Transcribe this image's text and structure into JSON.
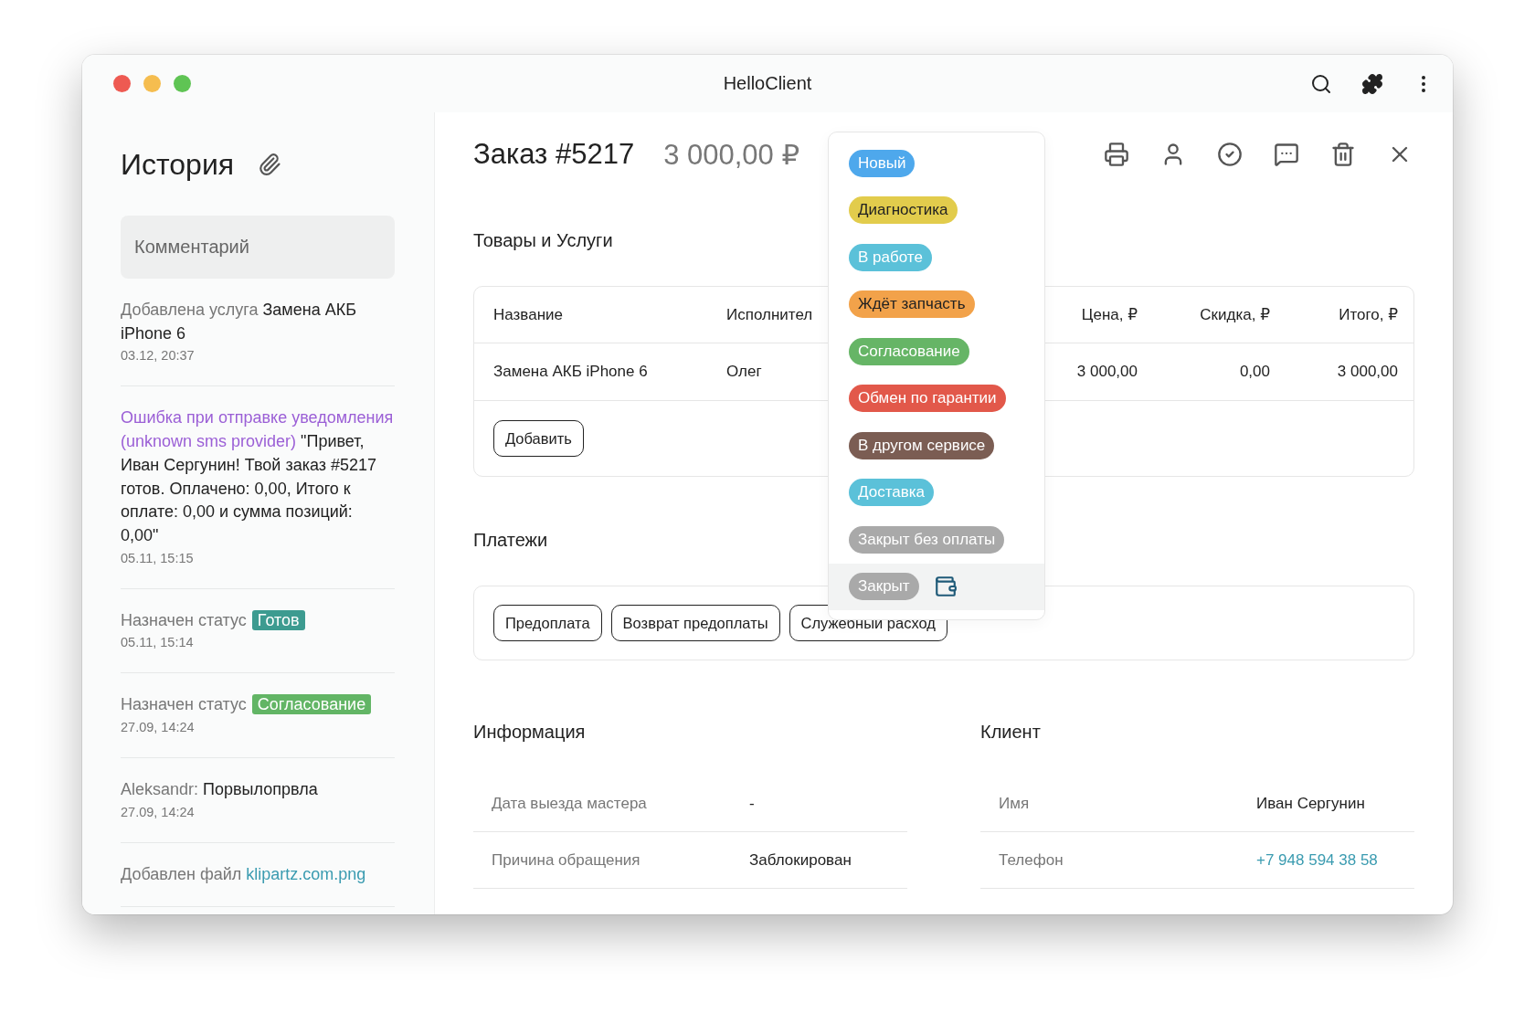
{
  "window": {
    "title": "HelloClient"
  },
  "history": {
    "title": "История",
    "comment": {
      "placeholder": "Комментарий"
    },
    "items": [
      {
        "kind": "service",
        "prefix": "Добавлена услуга",
        "value": "Замена АКБ iPhone 6",
        "date": "03.12, 20:37"
      },
      {
        "kind": "error",
        "prefix": "Ошибка при отправке уведомления (unknown sms provider)",
        "value": "\"Привет, Иван Сергунин! Твой заказ #5217 готов. Оплачено: 0,00, Итого к оплате: 0,00 и сумма позиций: 0,00\"",
        "date": "05.11, 15:15"
      },
      {
        "kind": "status",
        "prefix": "Назначен статус",
        "value": "Готов",
        "color": "#3d9b90",
        "date": "05.11, 15:14"
      },
      {
        "kind": "status",
        "prefix": "Назначен статус",
        "value": "Согласование",
        "color": "#62b565",
        "date": "27.09, 14:24"
      },
      {
        "kind": "comment",
        "prefix": "Aleksandr:",
        "value": "Порвылопрвла",
        "date": "27.09, 14:24"
      },
      {
        "kind": "file",
        "prefix": "Добавлен файл",
        "value": "klipartz.com.png"
      }
    ]
  },
  "order": {
    "title": "Заказ #5217",
    "amount": "3 000,00 ₽"
  },
  "goods": {
    "title": "Товары и Услуги",
    "columns": [
      "Название",
      "Исполнител",
      "Цена, ₽",
      "Скидка, ₽",
      "Итого, ₽"
    ],
    "rows": [
      {
        "cells": [
          "Замена АКБ iPhone 6",
          "Олег",
          "3 000,00",
          "0,00",
          "3 000,00"
        ]
      }
    ],
    "add_button": "Добавить"
  },
  "payments": {
    "title": "Платежи",
    "buttons": [
      "Предоплата",
      "Возврат предоплаты",
      "Служебный расход"
    ]
  },
  "statuses": [
    {
      "label": "Новый",
      "color": "#4ea8ec",
      "selected": false
    },
    {
      "label": "Диагностика",
      "color": "#e2cc4c",
      "selected": false
    },
    {
      "label": "В работе",
      "color": "#5bc1d9",
      "selected": false
    },
    {
      "label": "Ждёт запчасть",
      "color": "#f2a24a",
      "selected": false
    },
    {
      "label": "Согласование",
      "color": "#66b566",
      "selected": false
    },
    {
      "label": "Обмен по гарантии",
      "color": "#e2584a",
      "selected": false
    },
    {
      "label": "В другом сервисе",
      "color": "#7b5d53",
      "selected": false
    },
    {
      "label": "Доставка",
      "color": "#5bc1d9",
      "selected": false
    },
    {
      "label": "Закрыт без оплаты",
      "color": "#a9a9a9",
      "selected": false
    },
    {
      "label": "Закрыт",
      "color": "#a9a9a9",
      "selected": true
    }
  ],
  "info": {
    "title": "Информация",
    "rows": [
      {
        "label": "Дата выезда мастера",
        "value": "-",
        "link": false
      },
      {
        "label": "Причина обращения",
        "value": "Заблокирован",
        "link": false
      }
    ]
  },
  "client": {
    "title": "Клиент",
    "rows": [
      {
        "label": "Имя",
        "value": "Иван Сергунин",
        "link": false
      },
      {
        "label": "Телефон",
        "value": "+7 948 594 38 58",
        "link": true
      }
    ]
  }
}
